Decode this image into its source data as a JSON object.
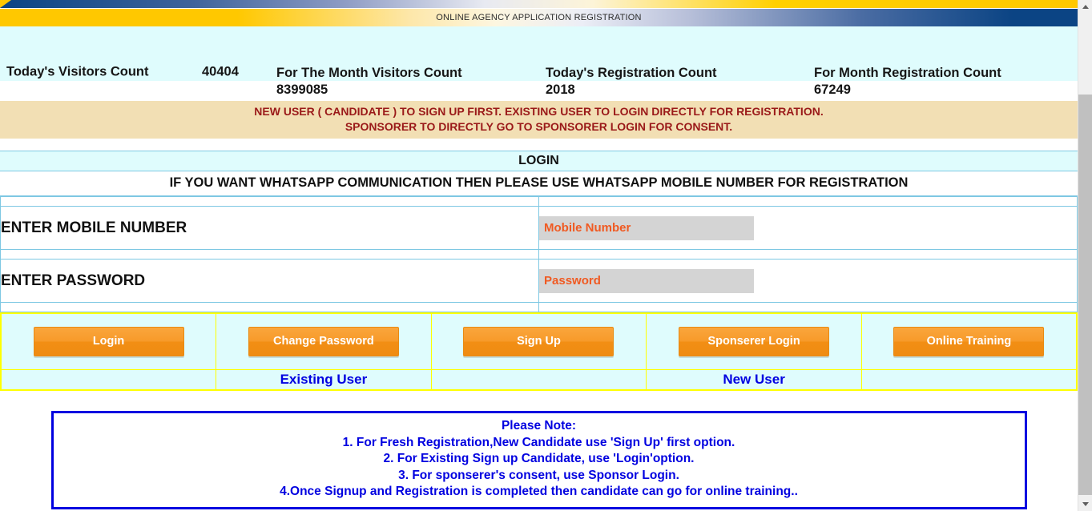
{
  "banner": {
    "title": "ONLINE AGENCY APPLICATION REGISTRATION"
  },
  "stats": {
    "today_visitors_label": "Today's Visitors Count",
    "today_visitors_value": "40404",
    "month_visitors_label": "For The Month Visitors Count",
    "month_visitors_value": "8399085",
    "today_registration_label": "Today's Registration Count",
    "today_registration_value": "2018",
    "month_registration_label": "For Month Registration Count",
    "month_registration_value": "67249"
  },
  "notice": {
    "line1": "NEW USER ( CANDIDATE ) TO SIGN UP FIRST. EXISTING USER TO LOGIN DIRECTLY FOR REGISTRATION.",
    "line2": "SPONSORER TO DIRECTLY GO TO SPONSORER LOGIN FOR CONSENT."
  },
  "login_section": {
    "heading": "LOGIN",
    "whatsapp_note": "IF YOU WANT WHATSAPP COMMUNICATION THEN PLEASE USE WHATSAPP MOBILE NUMBER FOR REGISTRATION",
    "mobile_label": "ENTER MOBILE NUMBER",
    "mobile_placeholder": "Mobile Number",
    "mobile_value": "",
    "password_label": "ENTER PASSWORD",
    "password_placeholder": "Password",
    "password_value": ""
  },
  "buttons": {
    "login": "Login",
    "change_password": "Change Password",
    "sign_up": "Sign Up",
    "sponserer_login": "Sponserer Login",
    "online_training": "Online Training"
  },
  "captions": {
    "existing_user": "Existing User",
    "new_user": "New User"
  },
  "note_box": {
    "title": "Please Note:",
    "line1": "1. For Fresh Registration,New Candidate use 'Sign Up' first option.",
    "line2": "2. For Existing Sign up Candidate, use 'Login'option.",
    "line3": "3. For sponserer's consent, use Sponsor Login.",
    "line4": "4.Once Signup and Registration is completed then candidate can go for online training.."
  },
  "colors": {
    "banner_yellow": "#ffc800",
    "banner_blue": "#0b4484",
    "stats_bg": "#dffcfd",
    "notice_bg": "#f2dfb4",
    "notice_text": "#9a1919",
    "button_orange": "#f7941e",
    "caption_blue": "#0000e0",
    "placeholder_orange": "#f05a22",
    "cell_border_yellow": "#ffff00",
    "cell_border_cyan": "#7ec8e3"
  }
}
